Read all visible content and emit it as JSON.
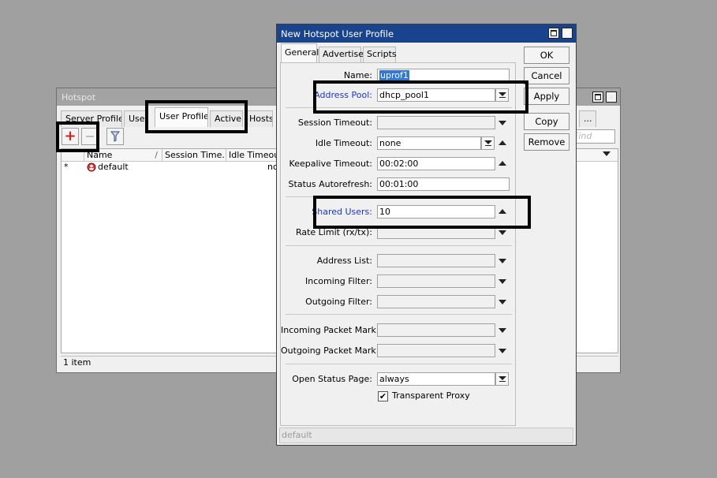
{
  "hotspot": {
    "title": "Hotspot",
    "tabs": [
      "Server Profiles",
      "Users",
      "User Profiles",
      "Active",
      "Hosts",
      "..."
    ],
    "find_placeholder": "Find",
    "columns": [
      "Name",
      "Session Time...",
      "Idle Timeout"
    ],
    "row": {
      "marker": "*",
      "name": "default",
      "idle_timeout": "no"
    },
    "status": "1 item"
  },
  "dialog": {
    "title": "New Hotspot User Profile",
    "tabs": [
      "General",
      "Advertise",
      "Scripts"
    ],
    "buttons": {
      "ok": "OK",
      "cancel": "Cancel",
      "apply": "Apply",
      "copy": "Copy",
      "remove": "Remove"
    },
    "fields": {
      "name": {
        "label": "Name:",
        "value": "uprof1"
      },
      "address_pool": {
        "label": "Address Pool:",
        "value": "dhcp_pool1"
      },
      "session_timeout": {
        "label": "Session Timeout:",
        "value": ""
      },
      "idle_timeout": {
        "label": "Idle Timeout:",
        "value": "none"
      },
      "keepalive_timeout": {
        "label": "Keepalive Timeout:",
        "value": "00:02:00"
      },
      "status_autorefresh": {
        "label": "Status Autorefresh:",
        "value": "00:01:00"
      },
      "shared_users": {
        "label": "Shared Users:",
        "value": "10"
      },
      "rate_limit": {
        "label": "Rate Limit (rx/tx):",
        "value": ""
      },
      "address_list": {
        "label": "Address List:",
        "value": ""
      },
      "incoming_filter": {
        "label": "Incoming Filter:",
        "value": ""
      },
      "outgoing_filter": {
        "label": "Outgoing Filter:",
        "value": ""
      },
      "incoming_packet_mark": {
        "label": "Incoming Packet Mark:",
        "value": ""
      },
      "outgoing_packet_mark": {
        "label": "Outgoing Packet Mark:",
        "value": ""
      },
      "open_status_page": {
        "label": "Open Status Page:",
        "value": "always"
      }
    },
    "transparent_proxy": {
      "label": "Transparent Proxy",
      "checked": true
    },
    "status": "default"
  },
  "colors": {
    "title_bar": "#19438c",
    "link_label": "#1b35c8",
    "add_icon": "#d42020",
    "highlight": "#000000"
  }
}
